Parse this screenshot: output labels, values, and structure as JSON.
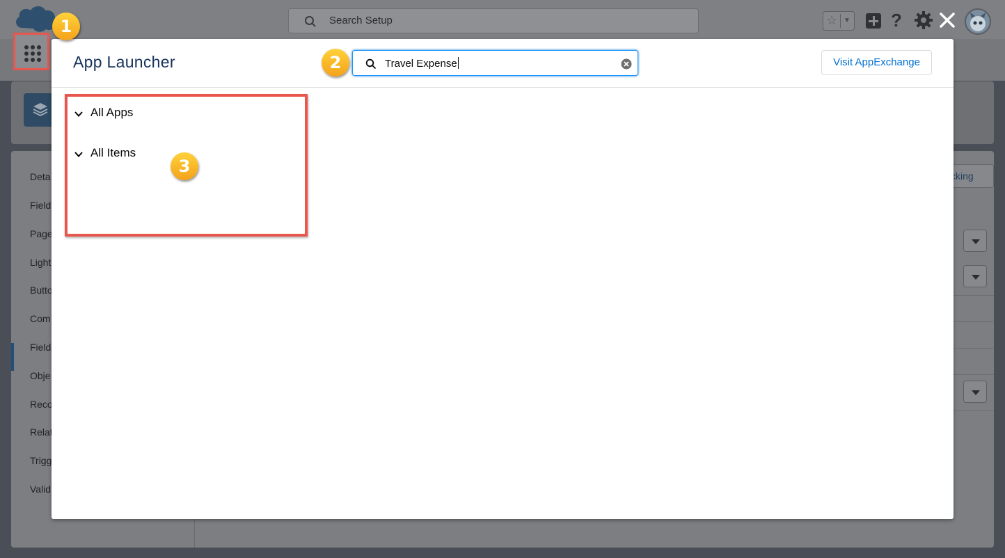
{
  "header": {
    "search_placeholder": "Search Setup"
  },
  "icons": {
    "logo": "salesforce-cloud-icon",
    "app_launcher": "waffle-grid-icon",
    "favorites": "star-icon",
    "global_actions": "plus-icon",
    "help": "question-mark-icon",
    "setup": "gear-icon",
    "close": "close-icon",
    "user": "avatar-icon",
    "object": "layers-icon",
    "search": "search-icon",
    "clear": "clear-icon",
    "chevron": "chevron-down-icon"
  },
  "help_label": "?",
  "background": {
    "sidenav_items": [
      "Deta",
      "Field",
      "Page",
      "Light",
      "Butto",
      "Com",
      "Field",
      "Obje",
      "Reco",
      "Relat",
      "Trigg",
      "Valid"
    ],
    "right_button": "cking"
  },
  "app_launcher": {
    "title": "App Launcher",
    "search_value": "Travel Expense",
    "visit_button": "Visit AppExchange",
    "sections": [
      "All Apps",
      "All Items"
    ]
  },
  "callouts": [
    "1",
    "2",
    "3"
  ],
  "colors": {
    "accent": "#0070d2",
    "highlight_border": "#e8564d",
    "badge": "#f4a21a"
  }
}
